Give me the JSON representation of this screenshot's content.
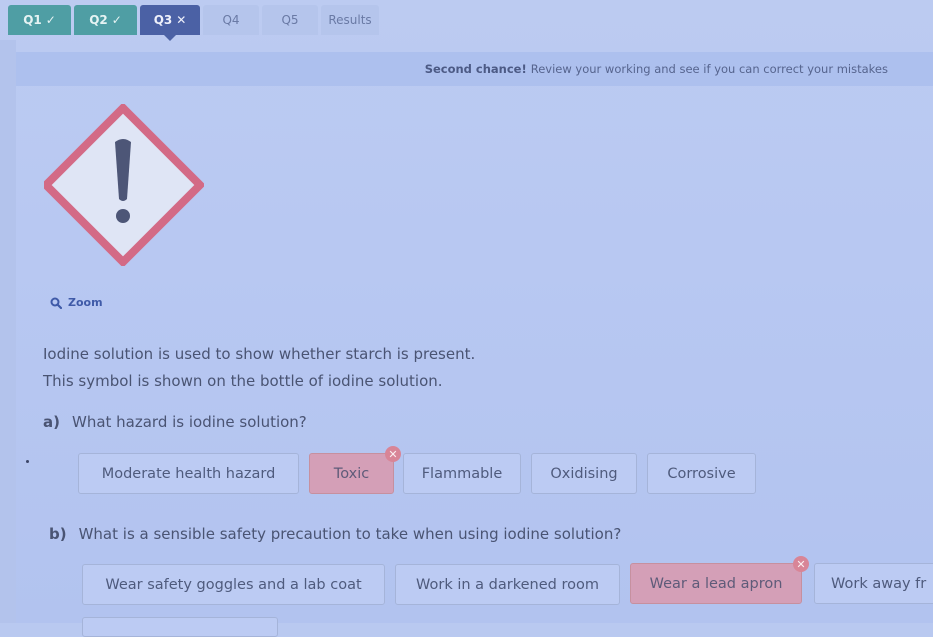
{
  "tabs": [
    {
      "label": "Q1",
      "status": "correct",
      "mark": "✓"
    },
    {
      "label": "Q2",
      "status": "correct",
      "mark": "✓"
    },
    {
      "label": "Q3",
      "status": "incorrect",
      "mark": "✕"
    },
    {
      "label": "Q4",
      "status": "pending",
      "mark": ""
    },
    {
      "label": "Q5",
      "status": "pending",
      "mark": ""
    },
    {
      "label": "Results",
      "status": "pending",
      "mark": ""
    }
  ],
  "banner": {
    "bold": "Second chance!",
    "text": "Review your working and see if you can correct your mistakes"
  },
  "hazard_symbol": {
    "icon": "exclamation-mark-hazard-icon",
    "border_color": "#d36a86"
  },
  "zoom_label": "Zoom",
  "intro": [
    "Iodine solution is used to show whether starch is present.",
    "This symbol is shown on the bottle of iodine solution."
  ],
  "questions": [
    {
      "letter": "a)",
      "text": "What hazard is iodine solution?",
      "options": [
        {
          "label": "Moderate health hazard",
          "state": "default"
        },
        {
          "label": "Toxic",
          "state": "wrong"
        },
        {
          "label": "Flammable",
          "state": "default"
        },
        {
          "label": "Oxidising",
          "state": "default"
        },
        {
          "label": "Corrosive",
          "state": "default"
        }
      ]
    },
    {
      "letter": "b)",
      "text": "What is a sensible safety precaution to take when using iodine solution?",
      "options": [
        {
          "label": "Wear safety goggles and a lab coat",
          "state": "default"
        },
        {
          "label": "Work in a darkened room",
          "state": "default"
        },
        {
          "label": "Wear a lead apron",
          "state": "wrong"
        },
        {
          "label": "Work away fr",
          "state": "default"
        }
      ]
    }
  ],
  "wrong_badge": "✕",
  "colors": {
    "tab_correct": "#4f9ea4",
    "tab_active": "#4b61a5",
    "wrong_option": "#d49fb7",
    "accent_link": "#3f5aa8"
  }
}
